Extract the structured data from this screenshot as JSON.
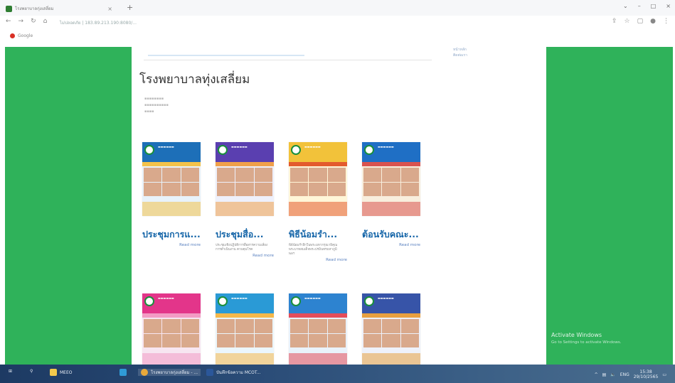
{
  "browser": {
    "tab_title": "โรงพยาบาลกุ่งเสลี่ยม",
    "url": "ไม่ปลอดภัย | 183.89.213.190:8080/...",
    "bookmark": "Google"
  },
  "page": {
    "title": "โรงพยาบาลทุ่งเสลี่ยม",
    "side_links": [
      "หน้าหลัก",
      "ติดต่อเรา"
    ]
  },
  "cards": [
    {
      "title": "ประชุมการแ...",
      "excerpt": "",
      "read_more": "Read more",
      "colors": [
        "#1d6fb8",
        "#e8f2fa",
        "#f3c24a"
      ]
    },
    {
      "title": "ประชุมสื่อ...",
      "excerpt": "ประชุมเชิงปฏิบัติการสื่อสารความเสี่ยง การดำเนินงาน ควบคุมโรค",
      "read_more": "Read more",
      "colors": [
        "#5a3fb0",
        "#eef0fb",
        "#f0a04a"
      ]
    },
    {
      "title": "พิธีน้อมรำ...",
      "excerpt": "พิธีน้อมรำลึกในพระมหากรุณาธิคุณ พระบาทสมเด็จพระปรมินทรมหาภูมิพลฯ",
      "read_more": "Read more",
      "colors": [
        "#f2c23a",
        "#fff6d8",
        "#e35b2d"
      ]
    },
    {
      "title": "ต้อนรับคณะ...",
      "excerpt": "",
      "read_more": "Read more",
      "colors": [
        "#1f6fc5",
        "#f8eedd",
        "#d9534f"
      ]
    },
    {
      "title": "",
      "excerpt": "",
      "read_more": "",
      "colors": [
        "#e3358a",
        "#f7e6f1",
        "#f29bc4"
      ]
    },
    {
      "title": "",
      "excerpt": "",
      "read_more": "",
      "colors": [
        "#2a9ad6",
        "#ebf6fc",
        "#f5b84a"
      ]
    },
    {
      "title": "",
      "excerpt": "",
      "read_more": "",
      "colors": [
        "#2d83d0",
        "#e9f2fb",
        "#e44d5a"
      ]
    },
    {
      "title": "",
      "excerpt": "",
      "read_more": "",
      "colors": [
        "#3754a8",
        "#eef1fa",
        "#e8a040"
      ]
    }
  ],
  "watermark": {
    "line1": "Activate Windows",
    "line2": "Go to Settings to activate Windows."
  },
  "taskbar": {
    "items": [
      "MEEO",
      "โรงพยาบาลกุ่งเสลี่ยม - ...",
      "บันทึกข้อความ MCOT..."
    ],
    "time": "15:38",
    "date": "29/10/2565",
    "lang": "ENG"
  },
  "colors": {
    "green": "#2fb25a",
    "link": "#1565a8"
  }
}
